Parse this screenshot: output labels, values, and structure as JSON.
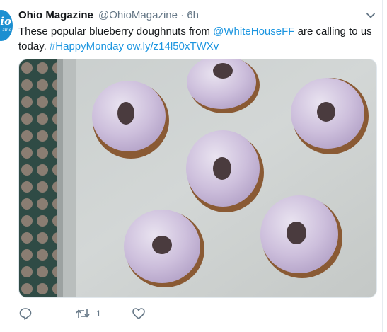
{
  "tweet": {
    "author_name": "Ohio Magazine",
    "handle": "@OhioMagazine",
    "separator": "·",
    "timestamp": "6h",
    "avatar": {
      "text": "io",
      "subtext": "zine"
    },
    "text_before_mention": "These popular blueberry doughnuts from ",
    "mention": "@WhiteHouseFF",
    "text_after_mention": " are calling to us today. ",
    "hashtag": "#HappyMonday",
    "url": "ow.ly/z14l50xTWXv",
    "media": {
      "subject": "blueberry doughnuts on a baking sheet"
    },
    "actions": {
      "reply_icon": "reply-icon",
      "retweet_icon": "retweet-icon",
      "retweet_count": "1",
      "like_icon": "heart-icon"
    },
    "menu_icon": "chevron-down-icon"
  },
  "colors": {
    "link": "#1b95e0",
    "text": "#14171a",
    "muted": "#657786",
    "avatar": "#1c8fd1"
  }
}
